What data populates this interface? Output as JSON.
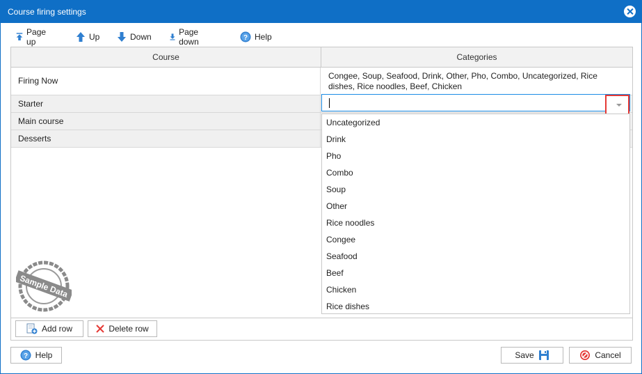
{
  "window": {
    "title": "Course firing settings"
  },
  "toolbar": {
    "page_up": "Page up",
    "up": "Up",
    "down": "Down",
    "page_down": "Page down",
    "help": "Help"
  },
  "grid": {
    "headers": {
      "course": "Course",
      "categories": "Categories"
    },
    "rows": [
      {
        "course": "Firing Now",
        "categories": "Congee, Soup, Seafood, Drink, Other, Pho, Combo, Uncategorized, Rice dishes, Rice noodles, Beef, Chicken"
      },
      {
        "course": "Starter",
        "categories": ""
      },
      {
        "course": "Main course",
        "categories": ""
      },
      {
        "course": "Desserts",
        "categories": ""
      }
    ]
  },
  "dropdown": {
    "options": [
      "Uncategorized",
      "Drink",
      "Pho",
      "Combo",
      "Soup",
      "Other",
      "Rice noodles",
      "Congee",
      "Seafood",
      "Beef",
      "Chicken",
      "Rice dishes"
    ]
  },
  "stamp": {
    "text": "Sample Data"
  },
  "footer": {
    "add_row": "Add row",
    "delete_row": "Delete row",
    "help": "Help",
    "save": "Save",
    "cancel": "Cancel"
  },
  "colors": {
    "titlebar": "#0f6fc6",
    "highlight_box": "#e53935",
    "focus_border": "#1a8ce6"
  }
}
